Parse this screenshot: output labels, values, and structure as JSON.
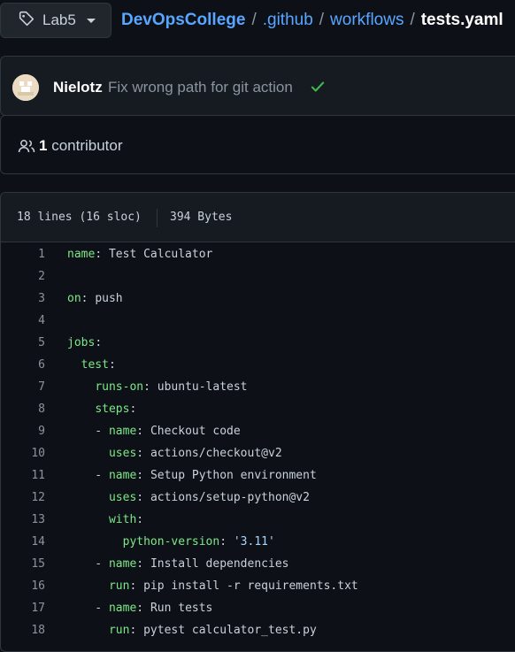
{
  "branch": {
    "label": "Lab5",
    "icon": "tag-icon"
  },
  "breadcrumb": {
    "repo": "DevOpsCollege",
    "path": [
      ".github",
      "workflows"
    ],
    "file": "tests.yaml",
    "separator": "/"
  },
  "commit": {
    "author": "Nielotz",
    "message": "Fix wrong path for git action",
    "status": "success",
    "status_icon": "check-icon"
  },
  "contributors": {
    "count": "1",
    "label": "contributor",
    "icon": "people-icon"
  },
  "file": {
    "lines": "18 lines (16 sloc)",
    "size": "394 Bytes"
  },
  "colors": {
    "background": "#0d1117",
    "link": "#58a6ff",
    "key": "#7ee787",
    "string": "#a5d6ff",
    "success": "#3fb950"
  },
  "code": [
    {
      "n": "1",
      "indent": "",
      "key": "name",
      "val": "Test Calculator"
    },
    {
      "n": "2",
      "indent": "",
      "key": "",
      "val": ""
    },
    {
      "n": "3",
      "indent": "",
      "key": "on",
      "val": "push"
    },
    {
      "n": "4",
      "indent": "",
      "key": "",
      "val": ""
    },
    {
      "n": "5",
      "indent": "",
      "key": "jobs",
      "val": ""
    },
    {
      "n": "6",
      "indent": "  ",
      "key": "test",
      "val": ""
    },
    {
      "n": "7",
      "indent": "    ",
      "key": "runs-on",
      "val": "ubuntu-latest"
    },
    {
      "n": "8",
      "indent": "    ",
      "key": "steps",
      "val": ""
    },
    {
      "n": "9",
      "indent": "    - ",
      "key": "name",
      "val": "Checkout code"
    },
    {
      "n": "10",
      "indent": "      ",
      "key": "uses",
      "val": "actions/checkout@v2"
    },
    {
      "n": "11",
      "indent": "    - ",
      "key": "name",
      "val": "Setup Python environment"
    },
    {
      "n": "12",
      "indent": "      ",
      "key": "uses",
      "val": "actions/setup-python@v2"
    },
    {
      "n": "13",
      "indent": "      ",
      "key": "with",
      "val": ""
    },
    {
      "n": "14",
      "indent": "        ",
      "key": "python-version",
      "val": "'3.11'",
      "str": true
    },
    {
      "n": "15",
      "indent": "    - ",
      "key": "name",
      "val": "Install dependencies"
    },
    {
      "n": "16",
      "indent": "      ",
      "key": "run",
      "val": "pip install -r requirements.txt"
    },
    {
      "n": "17",
      "indent": "    - ",
      "key": "name",
      "val": "Run tests"
    },
    {
      "n": "18",
      "indent": "      ",
      "key": "run",
      "val": "pytest calculator_test.py"
    }
  ]
}
